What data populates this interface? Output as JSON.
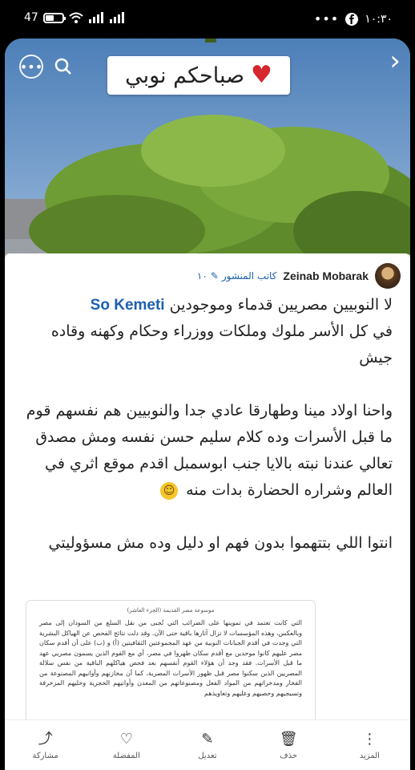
{
  "status_bar": {
    "left_text": "47",
    "battery_level": 0.47,
    "time": "١٠:٣٠",
    "icons": [
      "battery-icon",
      "wifi-icon",
      "signal-icon",
      "signal-icon",
      "more-icon",
      "facebook-icon"
    ]
  },
  "banner": {
    "text": "صباحكم نوبي",
    "emoji_icon": "heart-icon"
  },
  "author": {
    "name": "Zeinab Mobarak",
    "role": "كاتب المنشور",
    "count": "١٠"
  },
  "post": {
    "mention": "So Kemeti",
    "line1": "لا النوبيين مصريين قدماء وموجودين",
    "line2": "في كل الأسر ملوك وملكات ووزراء وحكام وكهنه وقاده جيش",
    "para2": "واحنا اولاد مينا وطهارقا عادي جدا والنوبيين هم نفسهم قوم ما قبل الأسرات وده كلام سليم حسن نفسه ومش مصدق تعالي عندنا نبته بالايا جنب ابوسمبل اقدم موقع اثري في العالم وشراره الحضارة بدات منه",
    "para3": "انتوا اللي بتتهموا بدون فهم او دليل وده مش مسؤوليتي"
  },
  "document": {
    "title": "موسوعة مصر القديمة (الجزء العاشر)",
    "body": "التي كانت تعتمد في تموينها على الضرائب التي تُجبى من نقل السلع من السودان إلى مصر وبالعكس، وهذه المؤسسات لا تزال آثارها باقية حتى الآن. وقد دلت نتائج الفحص عن الهياكل البشرية التي وجدت في أقدم الجبانات النوبية من عهد المجموعتين الثقافيتين (أ) و (ب) على أن أقدم سكان مصر عليهم كانوا موحدين مع أقدم سكان ظهروا في مصر، أي مع القوم الذين يسمون مصريي عهد ما قبل الأسرات. فقد وجد أن هؤلاء القوم أنفسهم بعد فحص هياكلهم الباقية من نفس سلالة المصريين الذين سكنوا مصر قبل ظهور الأسرات المصرية، كما أن مخازنهم وأوانيهم المصنوعة من الفخار ومدخراتهم من المواد الفعل ومصنوعاتهم من المعدن وأوانيهم الحجرية وحليهم المزخرفة وتسيجيهم وحصيهم وعليهم وتعاويذهم"
  },
  "bottom_nav": [
    {
      "label": "مشاركة",
      "icon": "share-icon",
      "glyph": "⤴"
    },
    {
      "label": "المفضلة",
      "icon": "favorite-icon",
      "glyph": "♡"
    },
    {
      "label": "تعديل",
      "icon": "edit-icon",
      "glyph": "✎"
    },
    {
      "label": "حذف",
      "icon": "delete-icon",
      "glyph": "🗑"
    },
    {
      "label": "المزيد",
      "icon": "more-vertical-icon",
      "glyph": "⋮"
    }
  ],
  "colors": {
    "accent": "#1d5fb0",
    "heart": "#d6262e"
  }
}
